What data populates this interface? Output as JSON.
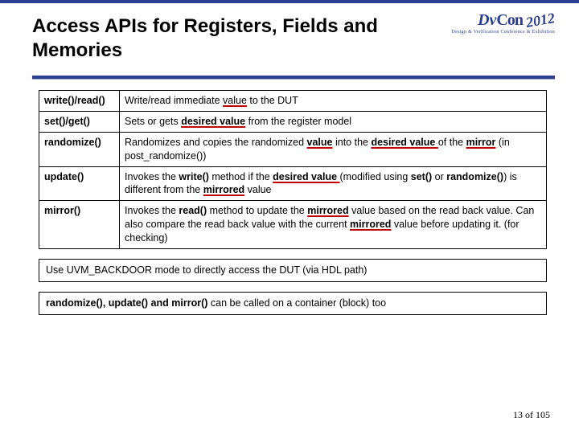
{
  "header": {
    "title": "Access APIs for Registers, Fields and Memories",
    "logo_dv": "Dv",
    "logo_con": "Con",
    "logo_year": "2012",
    "logo_sub": "Design & Verification Conference & Exhibition"
  },
  "table": {
    "rows": [
      {
        "fn": "write()/read()",
        "tpl": "row0",
        "p0": "Write/read immediate ",
        "u0": "value",
        "p1": " to the DUT"
      },
      {
        "fn": "set()/get()",
        "tpl": "row1",
        "p0": "Sets or gets ",
        "u0": "desired value",
        "p1": " from the register model"
      },
      {
        "fn": "randomize()",
        "tpl": "row2",
        "p0": "Randomizes and copies the randomized ",
        "u0": "value",
        "p1": " into the ",
        "u1": "desired value ",
        "p2": "of the ",
        "u2": "mirror",
        "p3": " (in post_randomize())"
      },
      {
        "fn": "update()",
        "tpl": "row3",
        "p0": "Invokes the ",
        "b0": "write()",
        "p1": " method if the ",
        "u0": "desired value ",
        "p2": "(modified using ",
        "b1": "set()",
        "p3": " or ",
        "b2": "randomize()",
        "p4": ") is different from the ",
        "u1": "mirrored",
        "p5": "  value"
      },
      {
        "fn": "mirror()",
        "tpl": "row4",
        "p0": "Invokes the ",
        "b0": "read()",
        "p1": " method to update the ",
        "u0": "mirrored",
        "p2": " value based on the read back value. Can also compare the read back value with the current ",
        "u1": "mirrored",
        "p3": " value before updating it. (for checking)"
      }
    ]
  },
  "notes": {
    "n1": "Use UVM_BACKDOOR mode to directly access the DUT (via HDL path)",
    "n2_b": "randomize(), update() and mirror()",
    "n2_rest": " can be called on a container (block) too"
  },
  "pager": {
    "current": "13",
    "of": " of ",
    "total": "105"
  }
}
